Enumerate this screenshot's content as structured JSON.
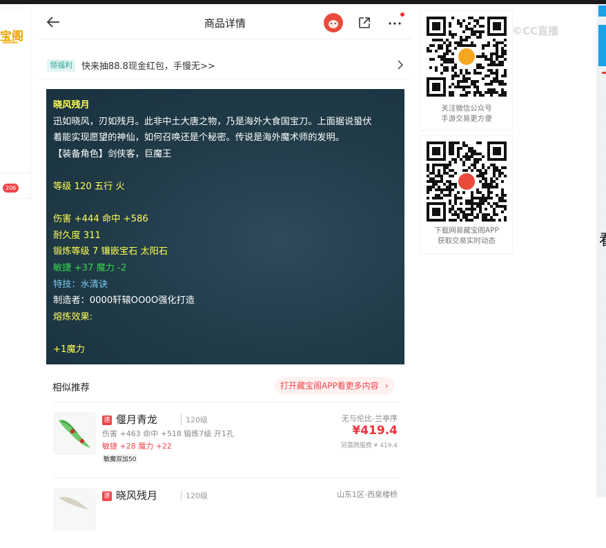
{
  "window": {
    "left_logo": "宝阁",
    "left_badge": "206",
    "watermark": "©CC直播",
    "right_edge_char": "看"
  },
  "header": {
    "title": "商品详情"
  },
  "promo": {
    "tag": "领福利",
    "text": "快来抽88.8现金红包，手慢无>>"
  },
  "item": {
    "lines": [
      {
        "text": "晓风残月",
        "color": "yellow",
        "bold": true
      },
      {
        "text": "迅如晓风，刃如残月。此非中土大唐之物，乃是海外大食国宝刀。上面据说蛩伏",
        "color": "white"
      },
      {
        "text": "着能实现愿望的神仙，如何召唤还是个秘密。传说是海外魔术师的发明。",
        "color": "white"
      },
      {
        "text": "【装备角色】剑侠客，巨魔王",
        "color": "white"
      },
      {
        "text": "",
        "color": "white"
      },
      {
        "text": "等级 120 五行 火",
        "color": "yellow"
      },
      {
        "text": "",
        "color": "white"
      },
      {
        "text": "伤害 +444 命中 +586",
        "color": "yellow"
      },
      {
        "text": "耐久度 311",
        "color": "yellow"
      },
      {
        "text": "锻炼等级 7 镶嵌宝石 太阳石",
        "color": "yellow"
      },
      {
        "text": "敏捷 +37 魔力 -2",
        "color": "green"
      },
      {
        "text": "特技：水清诀",
        "color": "blue"
      },
      {
        "text": "制造者：0000轩辕OO0O强化打造",
        "color": "white"
      },
      {
        "text": "熔炼效果:",
        "color": "yellow"
      },
      {
        "text": "",
        "color": "white"
      },
      {
        "text": "+1魔力",
        "color": "yellow"
      }
    ]
  },
  "similar": {
    "title": "相似推荐",
    "open_app": "打开藏宝阁APP看更多内容",
    "items": [
      {
        "tag": "速",
        "name": "偃月青龙",
        "level": "120级",
        "stats": "伤害 +463 命中 +518 锻炼7级 开1孔",
        "stats2": "敏捷 +28 魔力 +22",
        "label": "敏魔双加50",
        "server": "无与伦比-兰亭序",
        "price": "¥419.4",
        "price_note": "另需跨服费 ¥ 419.4"
      },
      {
        "tag": "速",
        "name": "晓风残月",
        "level": "120级",
        "server": "山东1区-西泉楼桥"
      }
    ]
  },
  "qr": [
    {
      "caption1": "关注微信公众号",
      "caption2": "手游交易更方便"
    },
    {
      "caption1": "下载网易藏宝阁APP",
      "caption2": "获取交易实时动态"
    }
  ],
  "colors": {
    "accent": "#f0454a",
    "panel_bg": "#203a47",
    "yellow": "#ffff52",
    "green": "#34d84b",
    "blue": "#7cc8f0"
  }
}
